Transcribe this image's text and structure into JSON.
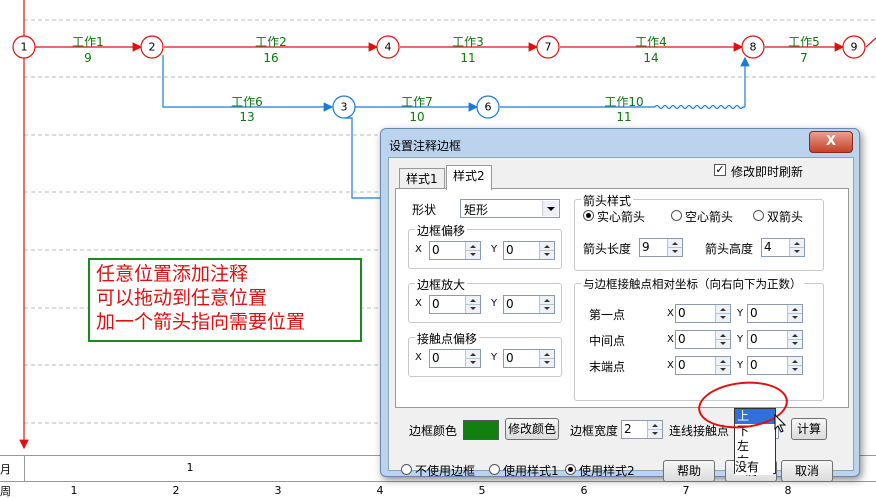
{
  "network": {
    "nodes": [
      "1",
      "2",
      "3",
      "4",
      "6",
      "7",
      "8",
      "9"
    ],
    "edges": [
      {
        "name": "工作1",
        "duration": "9"
      },
      {
        "name": "工作2",
        "duration": "16"
      },
      {
        "name": "工作3",
        "duration": "11"
      },
      {
        "name": "工作4",
        "duration": "14"
      },
      {
        "name": "工作5",
        "duration": "7"
      },
      {
        "name": "工作6",
        "duration": "13"
      },
      {
        "name": "工作7",
        "duration": "10"
      },
      {
        "name": "工作10",
        "duration": "11"
      }
    ],
    "colors": {
      "critical": "#e01010",
      "normal": "#1a7ad8",
      "label": "#0a7a0a"
    }
  },
  "timeline": {
    "month_label": "月",
    "month_value": "1",
    "week_label": "周",
    "weeks": [
      "1",
      "2",
      "3",
      "4",
      "5",
      "6",
      "7",
      "8"
    ]
  },
  "annotation": {
    "lines": [
      "任意位置添加注释",
      "可以拖动到任意位置",
      "加一个箭头指向需要位置"
    ]
  },
  "dialog": {
    "title": "设置注释边框",
    "close": "X",
    "refresh_label": "修改即时刷新",
    "tabs": [
      "样式1",
      "样式2"
    ],
    "shape_label": "形状",
    "shape_value": "矩形",
    "offset_group": "边框偏移",
    "enlarge_group": "边框放大",
    "contact_group": "接触点偏移",
    "x": "X",
    "y": "Y",
    "zero": "0",
    "arrow_group": "箭头样式",
    "arrow_options": [
      "实心箭头",
      "空心箭头",
      "双箭头"
    ],
    "arrow_length_label": "箭头长度",
    "arrow_length": "9",
    "arrow_height_label": "箭头高度",
    "arrow_height": "4",
    "coord_group": "与边框接触点相对坐标（向右向下为正数）",
    "coord_rows": [
      "第一点",
      "中间点",
      "末端点"
    ],
    "border_color_label": "边框颜色",
    "border_color": "#108010",
    "change_color_btn": "修改颜色",
    "border_width_label": "边框宽度",
    "border_width": "2",
    "link_contact_label": "连线接触点",
    "link_contact_value": "没有",
    "compute_btn": "计算",
    "dropdown_options": [
      "上",
      "下",
      "左",
      "右",
      "没有"
    ],
    "border_mode_options": [
      "不使用边框",
      "使用样式1",
      "使用样式2"
    ],
    "help_btn": "帮助",
    "ok_btn": "确",
    "cancel_btn": "取消"
  }
}
